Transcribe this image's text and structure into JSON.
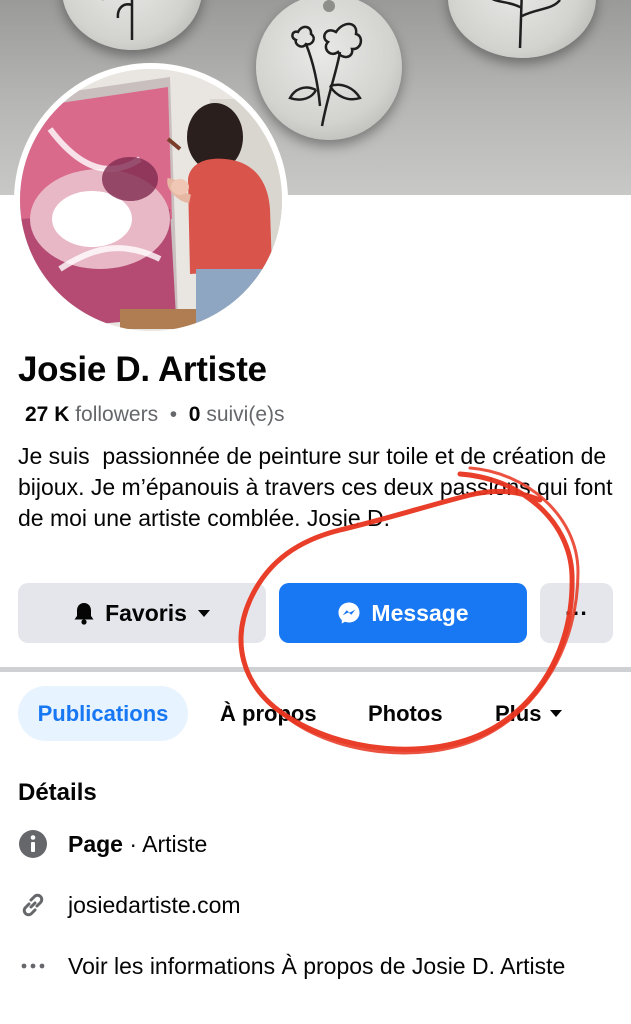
{
  "profile": {
    "name": "Josie D. Artiste",
    "followers_count": "27 K",
    "followers_label": "followers",
    "separator": "•",
    "following_count": "0",
    "following_label": "suivi(e)s",
    "bio": "Je suis  passionnée de peinture sur toile et de création de bijoux. Je m’épanouis à travers ces deux passions qui font de moi une artiste comblée. Josie D."
  },
  "actions": {
    "favorites_label": "Favoris",
    "message_label": "Message",
    "more_label": "···"
  },
  "tabs": [
    {
      "label": "Publications",
      "active": true
    },
    {
      "label": "À propos",
      "active": false
    },
    {
      "label": "Photos",
      "active": false
    },
    {
      "label": "Plus",
      "active": false
    }
  ],
  "details": {
    "title": "Détails",
    "page_label": "Page",
    "page_category": " · Artiste",
    "website": "josiedartiste.com",
    "see_more": "Voir les informations À propos de Josie D. Artiste"
  },
  "icons": {
    "favorites": "bell-icon",
    "favorites_caret": "caret-down-icon",
    "message": "messenger-icon",
    "tab_more_caret": "caret-down-icon",
    "page": "info-icon",
    "website": "link-icon",
    "see_more": "ellipsis-icon"
  },
  "colors": {
    "accent": "#1877f2",
    "active_tab_bg": "#e7f3ff",
    "button_gray": "#e4e6eb",
    "annotation_red": "#e8341e"
  }
}
